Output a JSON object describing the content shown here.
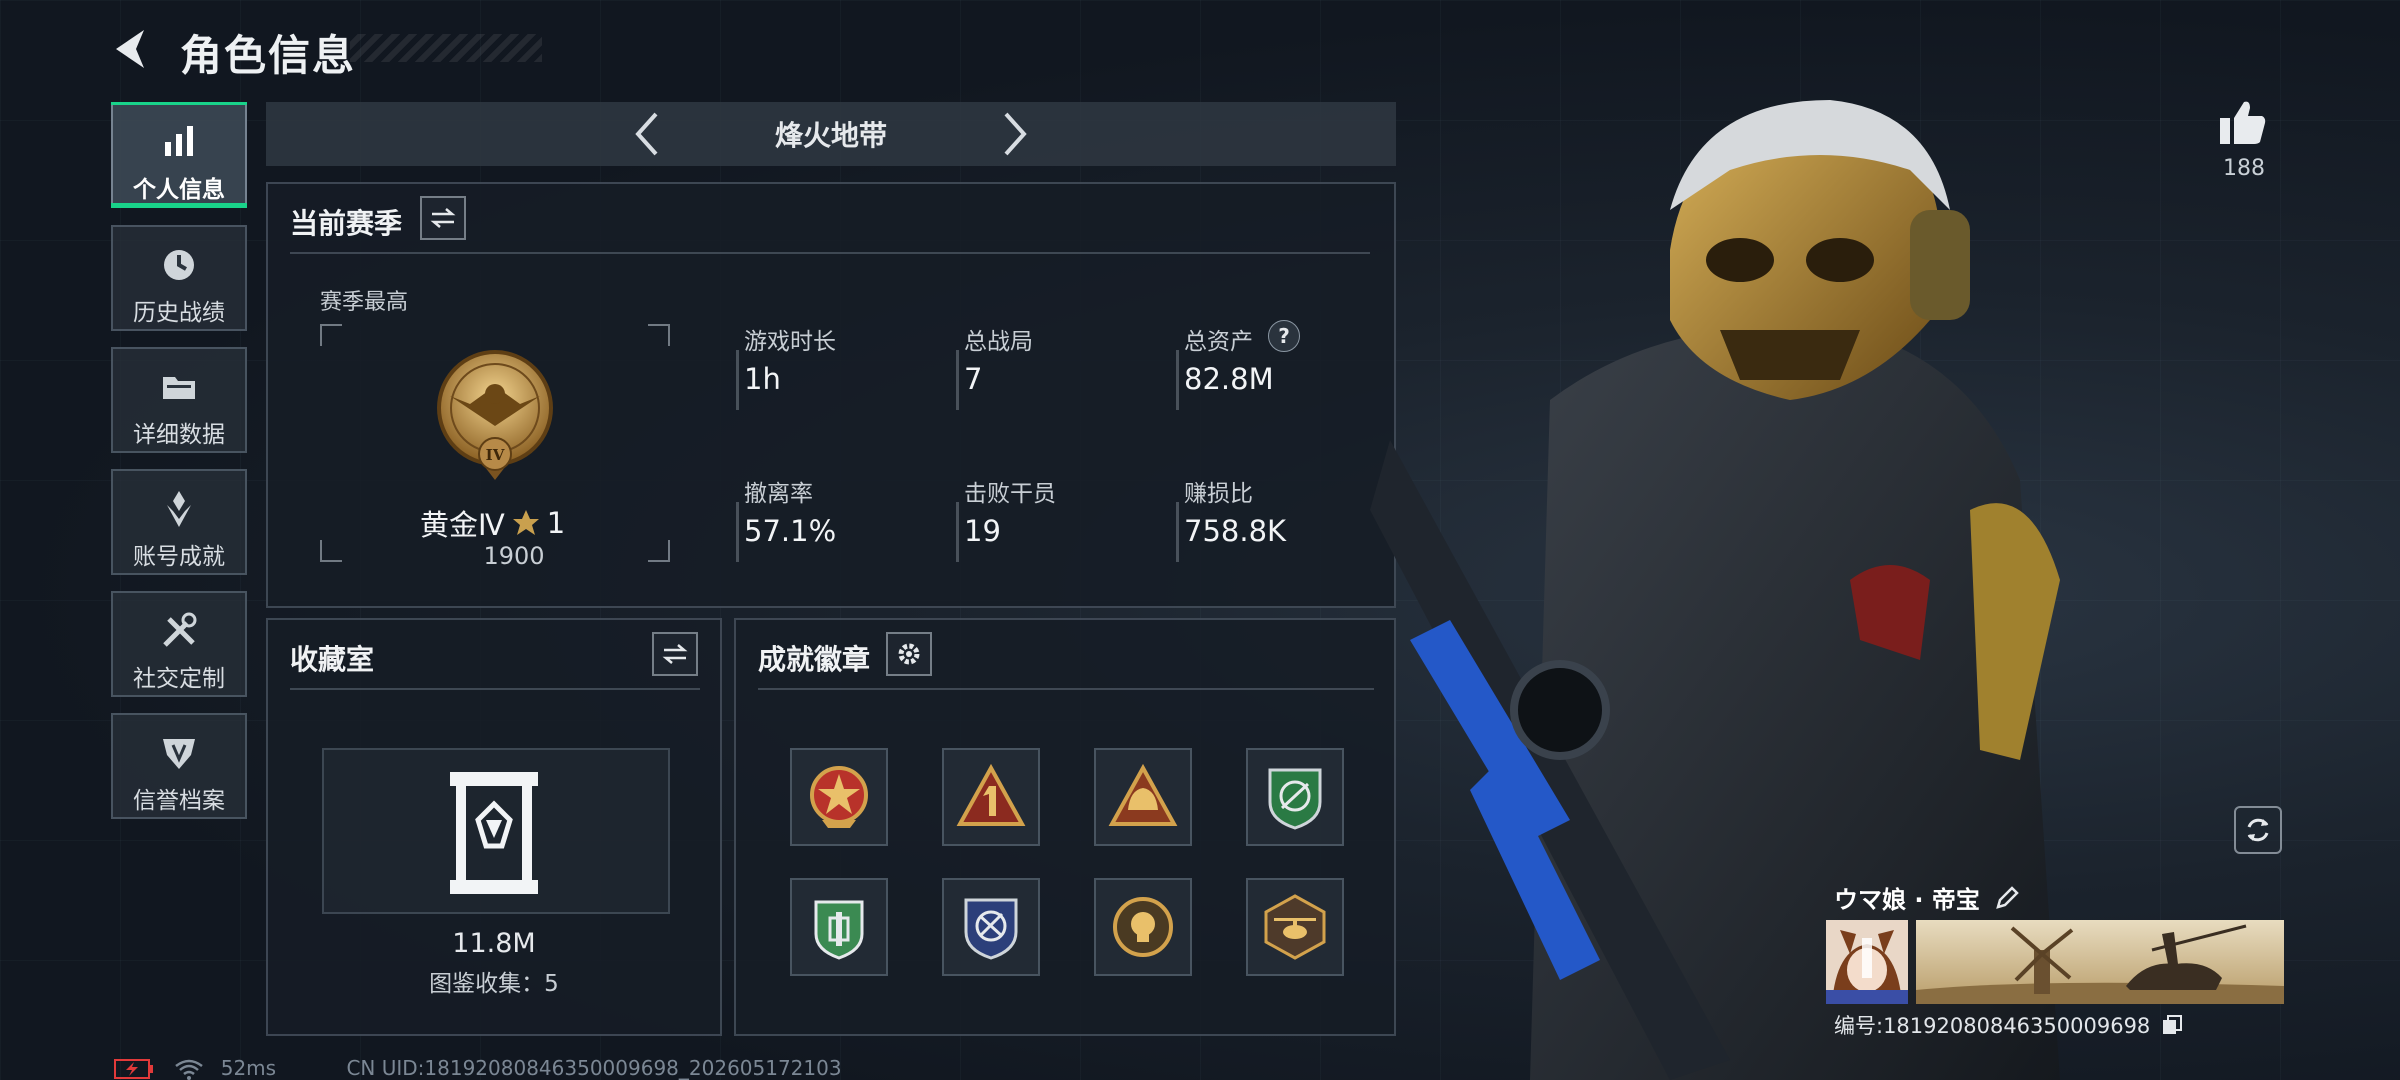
{
  "header": {
    "title": "角色信息"
  },
  "sidebar": {
    "items": [
      {
        "label": "个人信息",
        "icon": "bar-chart-icon",
        "active": true
      },
      {
        "label": "历史战绩",
        "icon": "history-clock-icon",
        "active": false
      },
      {
        "label": "详细数据",
        "icon": "folder-icon",
        "active": false
      },
      {
        "label": "账号成就",
        "icon": "achievement-icon",
        "active": false
      },
      {
        "label": "社交定制",
        "icon": "tools-icon",
        "active": false
      },
      {
        "label": "信誉档案",
        "icon": "reputation-icon",
        "active": false
      }
    ]
  },
  "mode_tab": {
    "title": "烽火地带"
  },
  "season": {
    "title": "当前赛季",
    "best_label": "赛季最高",
    "rank_name": "黄金Ⅳ",
    "rank_stars": "1",
    "rank_emblem_text": "IV",
    "rank_score": "1900",
    "stats": [
      {
        "label": "游戏时长",
        "value": "1h"
      },
      {
        "label": "总战局",
        "value": "7"
      },
      {
        "label": "总资产",
        "value": "82.8M",
        "help": "?"
      },
      {
        "label": "撤离率",
        "value": "57.1%"
      },
      {
        "label": "击败干员",
        "value": "19"
      },
      {
        "label": "赚损比",
        "value": "758.8K"
      }
    ]
  },
  "collection": {
    "title": "收藏室",
    "value": "11.8M",
    "count_label": "图鉴收集：5"
  },
  "badges": {
    "title": "成就徽章",
    "count": 8
  },
  "character": {
    "likes": "188",
    "name": "ウマ娘 · 帝宝",
    "uid_label": "编号:18192080846350009698"
  },
  "status_bar": {
    "ping": "52ms",
    "uid": "CN UID:18192080846350009698_202605172103"
  },
  "colors": {
    "accent_green": "#19d38a",
    "battery_red": "#e23a3a",
    "gold": "#c9a04e"
  }
}
